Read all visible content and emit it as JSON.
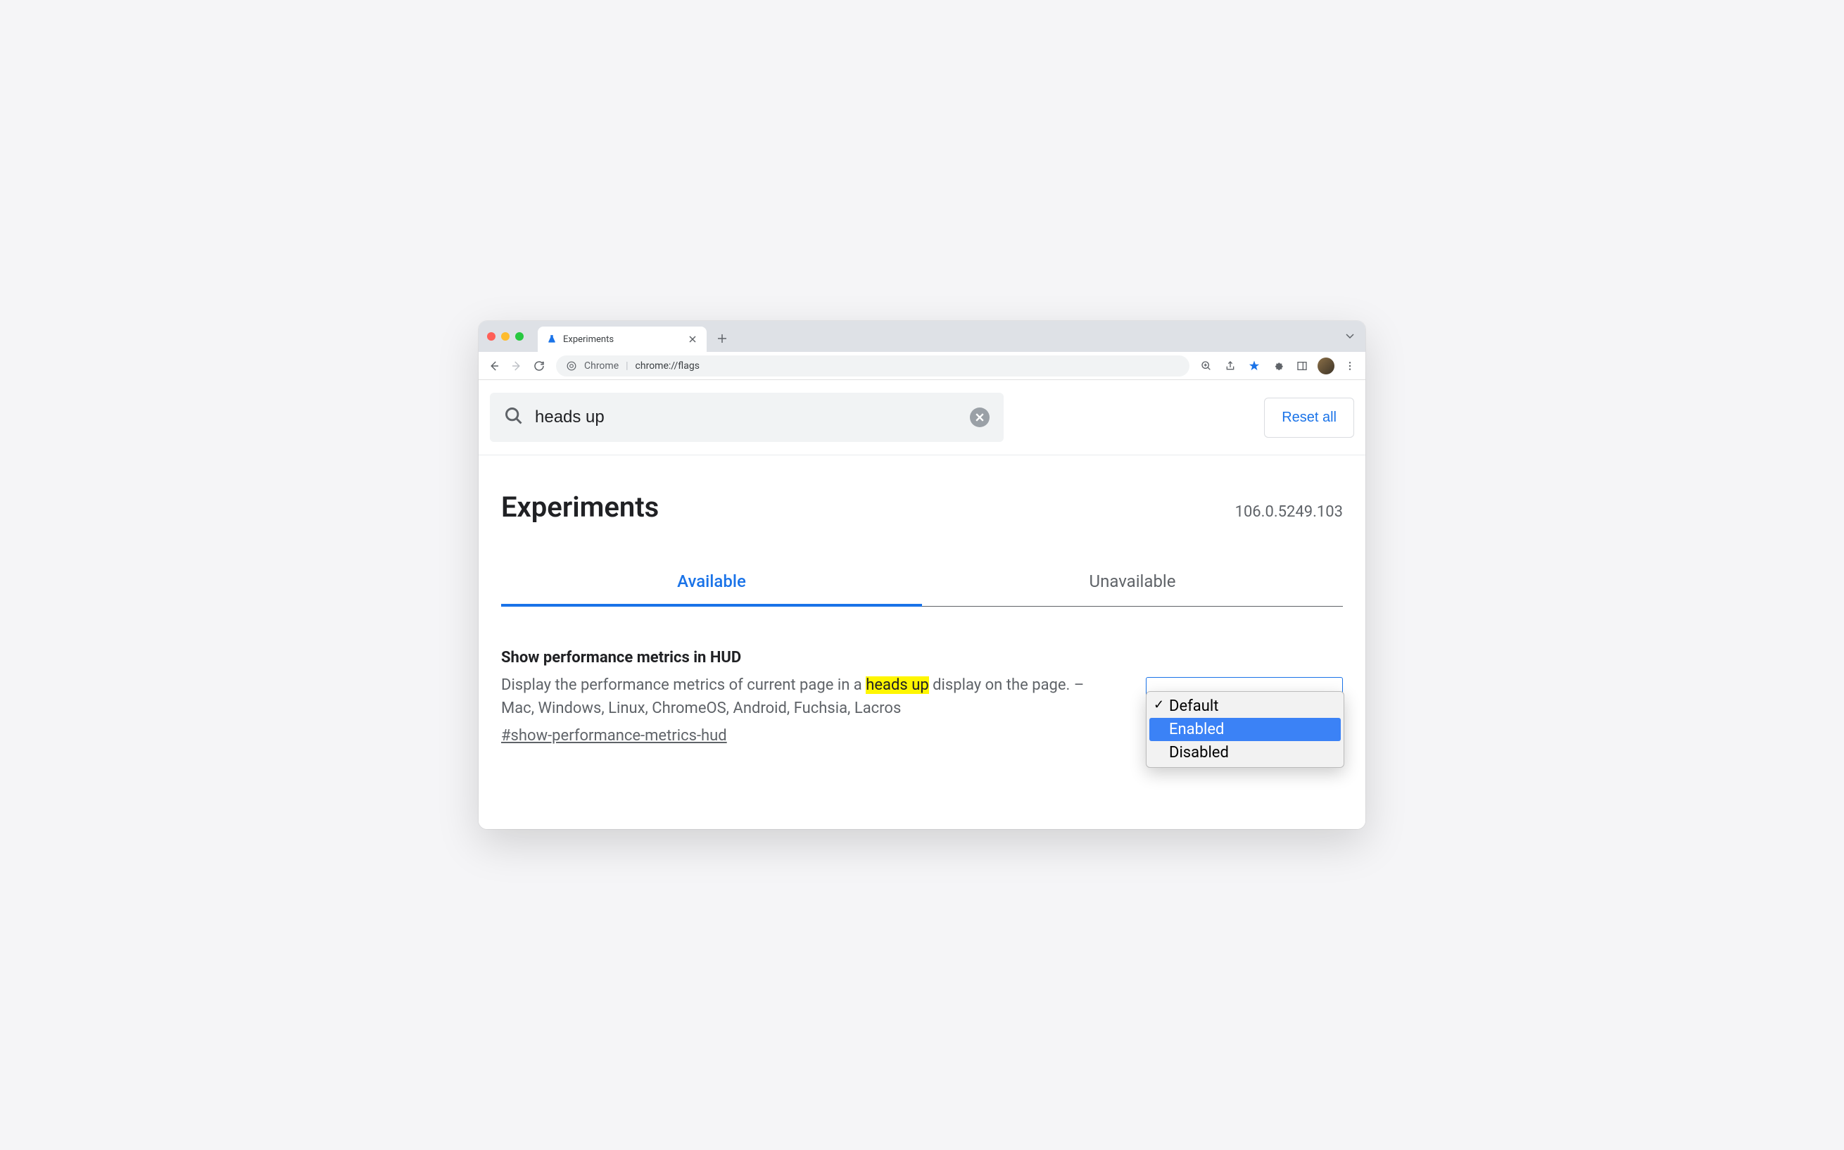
{
  "browser": {
    "tab": {
      "title": "Experiments"
    },
    "omnibox": {
      "prefix": "Chrome",
      "url": "chrome://flags"
    }
  },
  "search": {
    "value": "heads up",
    "reset_label": "Reset all"
  },
  "header": {
    "title": "Experiments",
    "version": "106.0.5249.103"
  },
  "tabs": {
    "available": "Available",
    "unavailable": "Unavailable"
  },
  "flag": {
    "title": "Show performance metrics in HUD",
    "desc_before": "Display the performance metrics of current page in a ",
    "desc_highlight": "heads up",
    "desc_after": " display on the page. – Mac, Windows, Linux, ChromeOS, Android, Fuchsia, Lacros",
    "anchor": "#show-performance-metrics-hud",
    "options": {
      "default": "Default",
      "enabled": "Enabled",
      "disabled": "Disabled"
    },
    "selected": "Default",
    "highlighted": "Enabled"
  }
}
